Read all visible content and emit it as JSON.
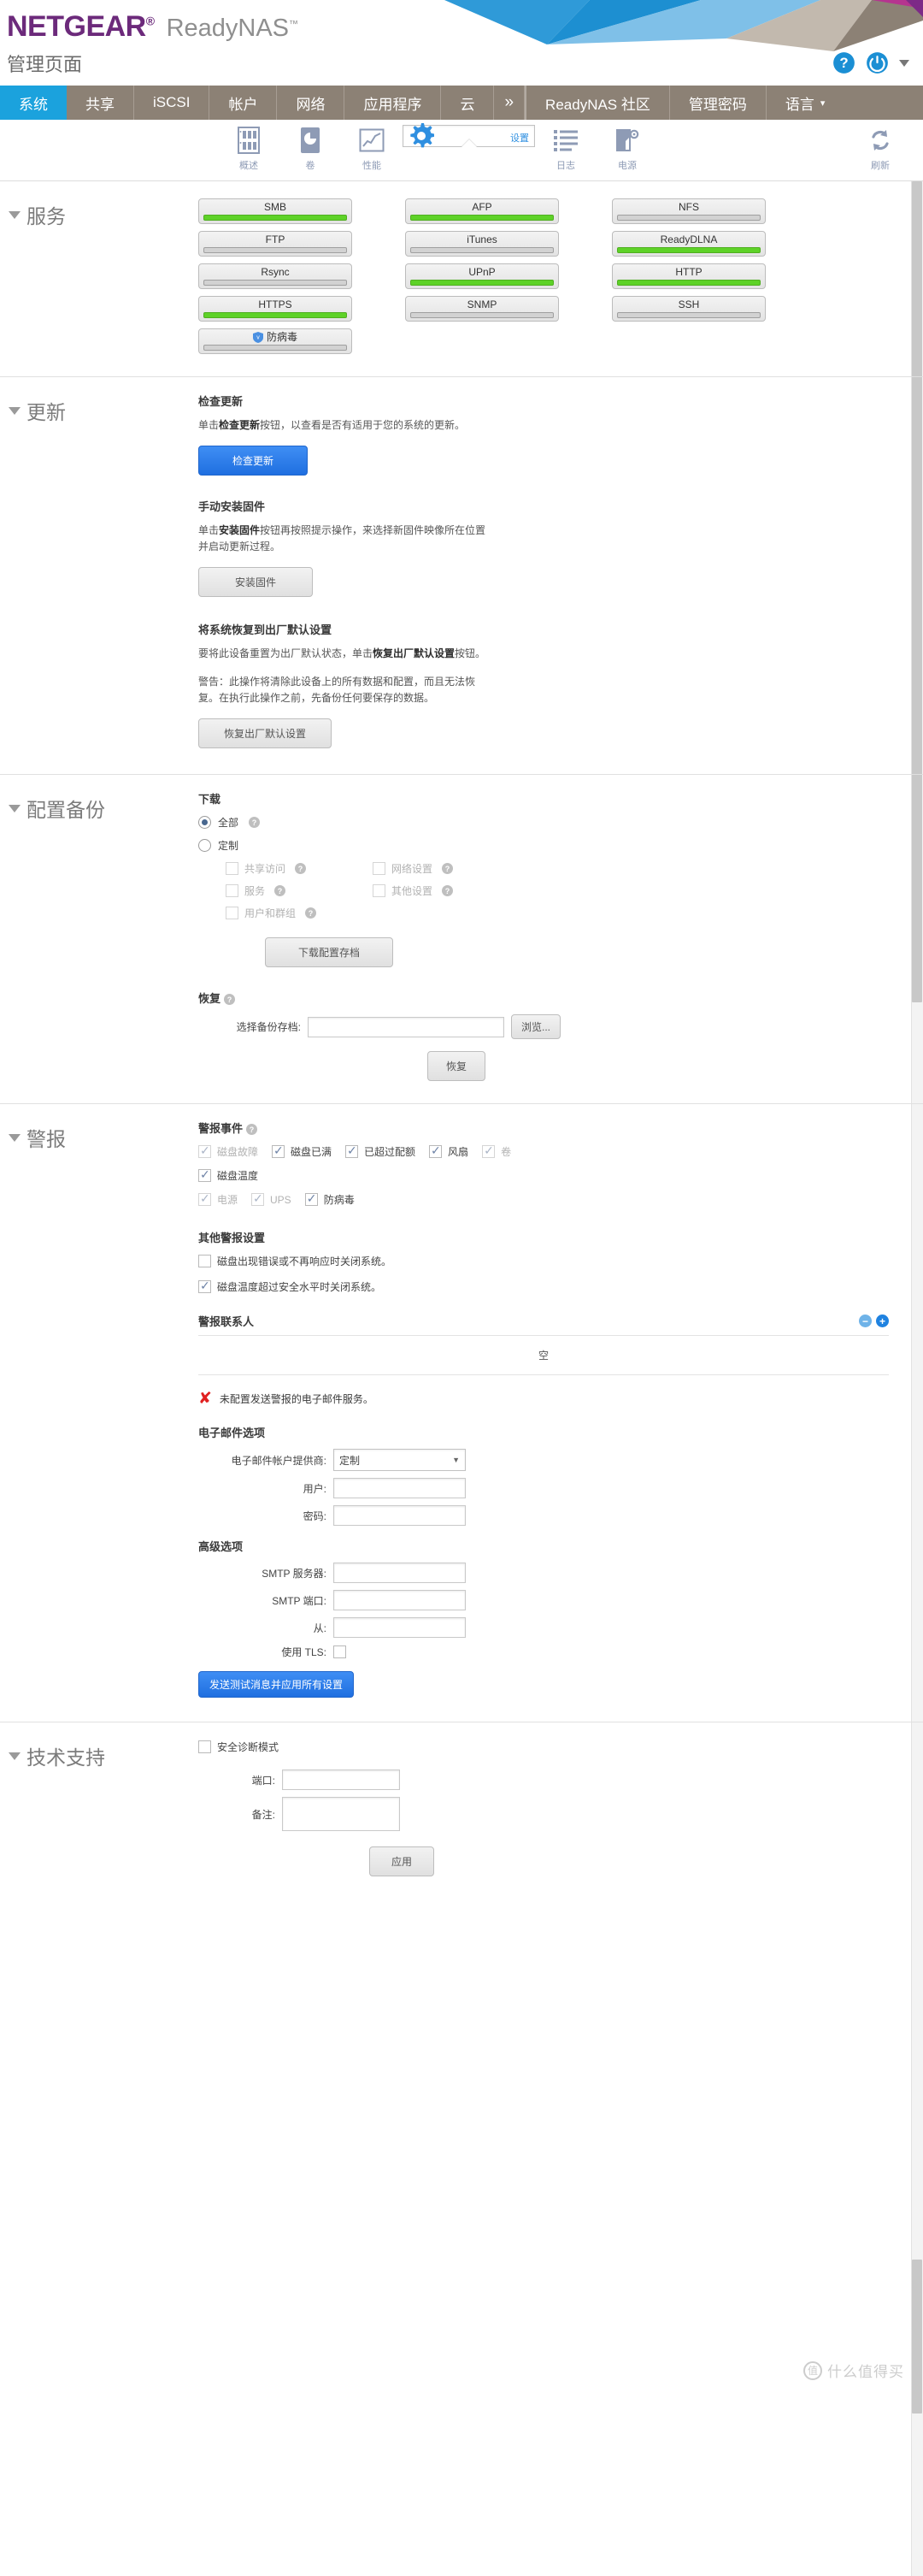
{
  "header": {
    "brand": "NETGEAR",
    "brand_mark": "®",
    "product": "ReadyNAS",
    "product_mark": "™",
    "admin_title": "管理页面",
    "help_icon": "help-circle-icon",
    "power_icon": "power-icon",
    "colors": {
      "brand_purple": "#6c2a7b",
      "accent_blue": "#1ba2dd",
      "nav_brown": "#8c8175"
    }
  },
  "nav": {
    "tabs": [
      {
        "label": "系统",
        "active": true
      },
      {
        "label": "共享",
        "active": false
      },
      {
        "label": "iSCSI",
        "active": false
      },
      {
        "label": "帐户",
        "active": false
      },
      {
        "label": "网络",
        "active": false
      },
      {
        "label": "应用程序",
        "active": false
      },
      {
        "label": "云",
        "active": false
      },
      {
        "label": "»",
        "active": false
      }
    ],
    "right_tabs": [
      {
        "label": "ReadyNAS 社区"
      },
      {
        "label": "管理密码"
      },
      {
        "label": "语言",
        "caret": "▾"
      }
    ]
  },
  "toolbar": {
    "items": [
      {
        "label": "概述",
        "icon": "device-chassis-icon",
        "selected": false
      },
      {
        "label": "卷",
        "icon": "volume-disk-icon",
        "selected": false
      },
      {
        "label": "性能",
        "icon": "performance-chart-icon",
        "selected": false
      },
      {
        "label": "设置",
        "icon": "gear-icon",
        "selected": true
      },
      {
        "label": "日志",
        "icon": "list-log-icon",
        "selected": false
      },
      {
        "label": "电源",
        "icon": "power-settings-icon",
        "selected": false
      }
    ],
    "refresh": {
      "label": "刷新",
      "icon": "refresh-icon"
    }
  },
  "services": {
    "title": "服务",
    "buttons": [
      {
        "name": "SMB",
        "enabled": true
      },
      {
        "name": "AFP",
        "enabled": true
      },
      {
        "name": "NFS",
        "enabled": false
      },
      {
        "name": "FTP",
        "enabled": false
      },
      {
        "name": "iTunes",
        "enabled": false
      },
      {
        "name": "ReadyDLNA",
        "enabled": true
      },
      {
        "name": "Rsync",
        "enabled": false
      },
      {
        "name": "UPnP",
        "enabled": true
      },
      {
        "name": "HTTP",
        "enabled": true
      },
      {
        "name": "HTTPS",
        "enabled": true
      },
      {
        "name": "SNMP",
        "enabled": false
      },
      {
        "name": "SSH",
        "enabled": false
      },
      {
        "name": "防病毒",
        "enabled": false,
        "icon": "shield-icon"
      }
    ]
  },
  "update": {
    "title": "更新",
    "check_heading": "检查更新",
    "check_desc_a": "单击",
    "check_desc_b": "检查更新",
    "check_desc_c": "按钮，以查看是否有适用于您的系统的更新。",
    "check_button": "检查更新",
    "manual_heading": "手动安装固件",
    "manual_desc_a": "单击",
    "manual_desc_b": "安装固件",
    "manual_desc_c": "按钮再按照提示操作，来选择新固件映像所在位置并启动更新过程。",
    "install_button": "安装固件",
    "factory_heading": "将系统恢复到出厂默认设置",
    "factory_desc_a": "要将此设备重置为出厂默认状态，单击",
    "factory_desc_b": "恢复出厂默认设置",
    "factory_desc_c": "按钮。",
    "factory_warning": "警告：此操作将清除此设备上的所有数据和配置，而且无法恢复。在执行此操作之前，先备份任何要保存的数据。",
    "factory_button": "恢复出厂默认设置"
  },
  "backup": {
    "title": "配置备份",
    "download_heading": "下载",
    "radio_all": "全部",
    "radio_custom": "定制",
    "all_selected": true,
    "custom_items": [
      {
        "label": "共享访问",
        "checked": false,
        "disabled": true
      },
      {
        "label": "网络设置",
        "checked": false,
        "disabled": true
      },
      {
        "label": "服务",
        "checked": false,
        "disabled": true
      },
      {
        "label": "其他设置",
        "checked": false,
        "disabled": true
      },
      {
        "label": "用户和群组",
        "checked": false,
        "disabled": true
      }
    ],
    "download_button": "下载配置存档",
    "restore_heading": "恢复",
    "select_archive_label": "选择备份存档:",
    "archive_value": "",
    "browse_button": "浏览...",
    "restore_button": "恢复"
  },
  "alerts": {
    "title": "警报",
    "events_heading": "警报事件",
    "events": [
      {
        "label": "磁盘故障",
        "checked": true,
        "disabled": true
      },
      {
        "label": "磁盘已满",
        "checked": true,
        "disabled": false
      },
      {
        "label": "已超过配额",
        "checked": true,
        "disabled": false
      },
      {
        "label": "风扇",
        "checked": true,
        "disabled": false
      },
      {
        "label": "卷",
        "checked": true,
        "disabled": true
      },
      {
        "label": "磁盘温度",
        "checked": true,
        "disabled": false
      },
      {
        "label": "电源",
        "checked": true,
        "disabled": true
      },
      {
        "label": "UPS",
        "checked": true,
        "disabled": true
      },
      {
        "label": "防病毒",
        "checked": true,
        "disabled": false
      }
    ],
    "other_heading": "其他警报设置",
    "other_settings": [
      {
        "label": "磁盘出现错误或不再响应时关闭系统。",
        "checked": false
      },
      {
        "label": "磁盘温度超过安全水平时关闭系统。",
        "checked": true
      }
    ],
    "contacts_heading": "警报联系人",
    "contacts_empty": "空",
    "remove_icon": "minus-circle-icon",
    "add_icon": "plus-circle-icon",
    "email_error": "未配置发送警报的电子邮件服务。",
    "email_heading": "电子邮件选项",
    "provider_label": "电子邮件帐户提供商:",
    "provider_value": "定制",
    "user_label": "用户:",
    "user_value": "",
    "password_label": "密码:",
    "password_value": "",
    "advanced_heading": "高级选项",
    "smtp_server_label": "SMTP 服务器:",
    "smtp_server_value": "",
    "smtp_port_label": "SMTP 端口:",
    "smtp_port_value": "",
    "from_label": "从:",
    "from_value": "",
    "tls_label": "使用 TLS:",
    "tls_checked": false,
    "test_button": "发送测试消息并应用所有设置"
  },
  "support": {
    "title": "技术支持",
    "safe_mode_label": "安全诊断模式",
    "safe_mode_checked": false,
    "port_label": "端口:",
    "port_value": "",
    "note_label": "备注:",
    "note_value": "",
    "apply_button": "应用"
  },
  "watermark": {
    "badge": "值",
    "text": "什么值得买"
  }
}
